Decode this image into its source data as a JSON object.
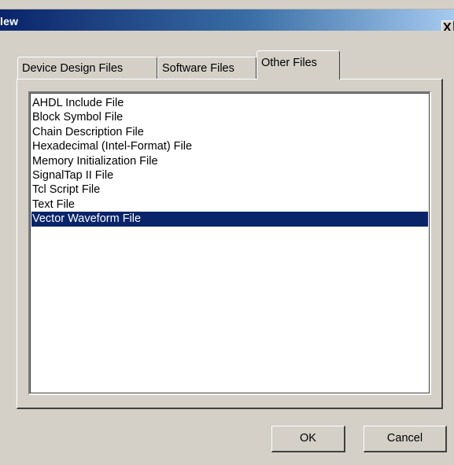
{
  "window": {
    "title": "lew",
    "close_glyph": "X"
  },
  "tabs": [
    {
      "label": "Device Design Files",
      "active": false
    },
    {
      "label": "Software Files",
      "active": false
    },
    {
      "label": "Other Files",
      "active": true
    }
  ],
  "file_list": {
    "items": [
      "AHDL Include File",
      "Block Symbol File",
      "Chain Description File",
      "Hexadecimal (Intel-Format) File",
      "Memory Initialization File",
      "SignalTap II File",
      "Tcl Script File",
      "Text File",
      "Vector Waveform File"
    ],
    "selected": "Vector Waveform File"
  },
  "buttons": {
    "ok_label": "OK",
    "cancel_label": "Cancel"
  },
  "colors": {
    "selection": "#0a246a",
    "dialog_face": "#d4d0c8",
    "titlebar_start": "#0a246a",
    "titlebar_end": "#a6caf0"
  }
}
